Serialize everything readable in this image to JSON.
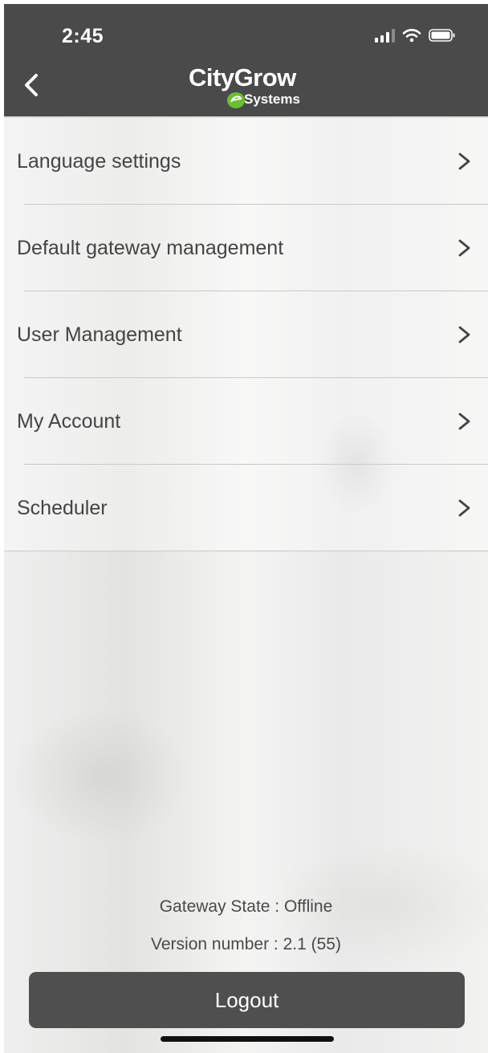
{
  "status_bar": {
    "time": "2:45",
    "icons": [
      "signal-icon",
      "wifi-icon",
      "battery-icon"
    ]
  },
  "header": {
    "back_icon": "chevron-left-icon",
    "logo": {
      "line1": "CityGrow",
      "line2": "Systems"
    }
  },
  "menu": {
    "items": [
      {
        "label": "Language settings",
        "icon": "chevron-right-icon"
      },
      {
        "label": "Default gateway management",
        "icon": "chevron-right-icon"
      },
      {
        "label": "User Management",
        "icon": "chevron-right-icon"
      },
      {
        "label": "My Account",
        "icon": "chevron-right-icon"
      },
      {
        "label": "Scheduler",
        "icon": "chevron-right-icon"
      }
    ]
  },
  "footer": {
    "gateway_state": "Gateway State : Offline",
    "version": "Version number : 2.1 (55)",
    "logout_label": "Logout"
  },
  "colors": {
    "header_bg": "#4a4a4a",
    "logo_accent": "#6abf2e",
    "button_bg": "#4f4f4f",
    "text": "#444444"
  }
}
